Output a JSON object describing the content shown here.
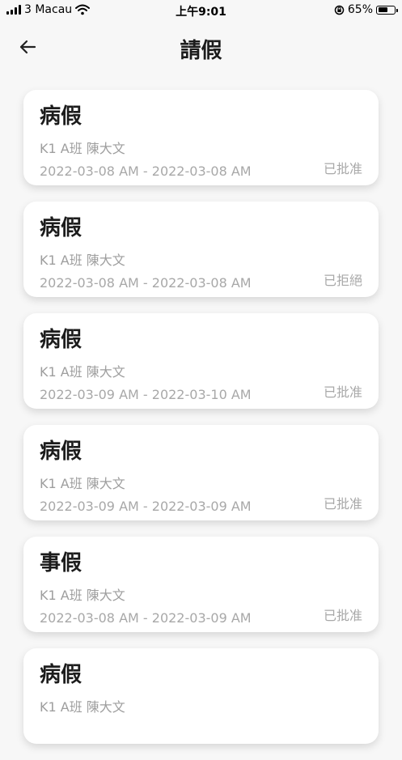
{
  "status_bar": {
    "carrier": "3 Macau",
    "time": "上午9:01",
    "battery": "65%",
    "battery_level": 0.65
  },
  "header": {
    "title": "請假",
    "back_icon": "arrow-left-icon"
  },
  "leaves": [
    {
      "type": "病假",
      "class_name": "K1 A班 陳大文",
      "dates": "2022-03-08 AM - 2022-03-08 AM",
      "status": "已批准"
    },
    {
      "type": "病假",
      "class_name": "K1 A班 陳大文",
      "dates": "2022-03-08 AM - 2022-03-08 AM",
      "status": "已拒絕"
    },
    {
      "type": "病假",
      "class_name": "K1 A班 陳大文",
      "dates": "2022-03-09 AM - 2022-03-10 AM",
      "status": "已批准"
    },
    {
      "type": "病假",
      "class_name": "K1 A班 陳大文",
      "dates": "2022-03-09 AM - 2022-03-09 AM",
      "status": "已批准"
    },
    {
      "type": "事假",
      "class_name": "K1 A班 陳大文",
      "dates": "2022-03-08 AM - 2022-03-09 AM",
      "status": "已批准"
    },
    {
      "type": "病假",
      "class_name": "K1 A班 陳大文",
      "dates": "",
      "status": ""
    }
  ]
}
